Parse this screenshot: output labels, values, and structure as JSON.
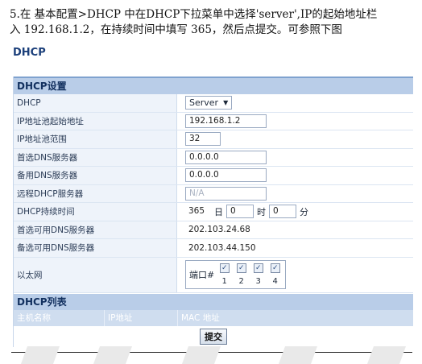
{
  "instructions": {
    "line1": "5.在 基本配置>DHCP 中在DHCP下拉菜单中选择'server',IP的起始地址栏",
    "line2": "入 192.168.1.2，在持续时间中填写 365，然后点提交。可参照下图"
  },
  "page_title": "DHCP",
  "settings": {
    "header": "DHCP设置",
    "dhcp_label": "DHCP",
    "dhcp_value": "Server",
    "ip_start_label": "IP地址池起始地址",
    "ip_start_value": "192.168.1.2",
    "ip_range_label": "IP地址池范围",
    "ip_range_value": "32",
    "primary_dns_label": "首选DNS服务器",
    "primary_dns_value": "0.0.0.0",
    "secondary_dns_label": "备用DNS服务器",
    "secondary_dns_value": "0.0.0.0",
    "remote_dhcp_label": "远程DHCP服务器",
    "remote_dhcp_placeholder": "N/A",
    "lease_label": "DHCP持续时间",
    "lease_days": "365",
    "lease_days_unit": "日",
    "lease_hours": "0",
    "lease_hours_unit": "时",
    "lease_minutes": "0",
    "lease_minutes_unit": "分",
    "avail_primary_dns_label": "首选可用DNS服务器",
    "avail_primary_dns_value": "202.103.24.68",
    "avail_secondary_dns_label": "备选可用DNS服务器",
    "avail_secondary_dns_value": "202.103.44.150",
    "ethernet_label": "以太网",
    "port_label": "端口#",
    "ports": [
      "1",
      "2",
      "3",
      "4"
    ]
  },
  "list": {
    "header": "DHCP列表",
    "columns": [
      "主机名称",
      "IP地址",
      "MAC 地址"
    ]
  },
  "submit_label": "提交"
}
